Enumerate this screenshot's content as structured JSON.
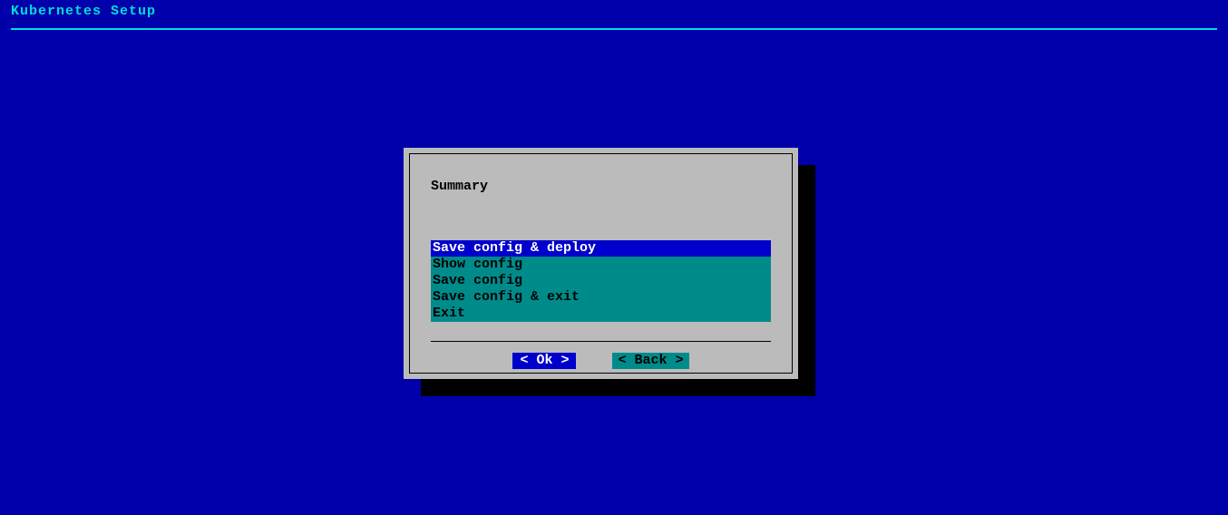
{
  "header": {
    "title": "Kubernetes Setup"
  },
  "dialog": {
    "title": "Summary",
    "menu": {
      "items": [
        {
          "label": "Save config & deploy",
          "selected": true
        },
        {
          "label": "Show config",
          "selected": false
        },
        {
          "label": "Save config",
          "selected": false
        },
        {
          "label": "Save config & exit",
          "selected": false
        },
        {
          "label": "Exit",
          "selected": false
        }
      ]
    },
    "buttons": {
      "ok": "<  Ok  >",
      "back": "< Back >"
    }
  }
}
